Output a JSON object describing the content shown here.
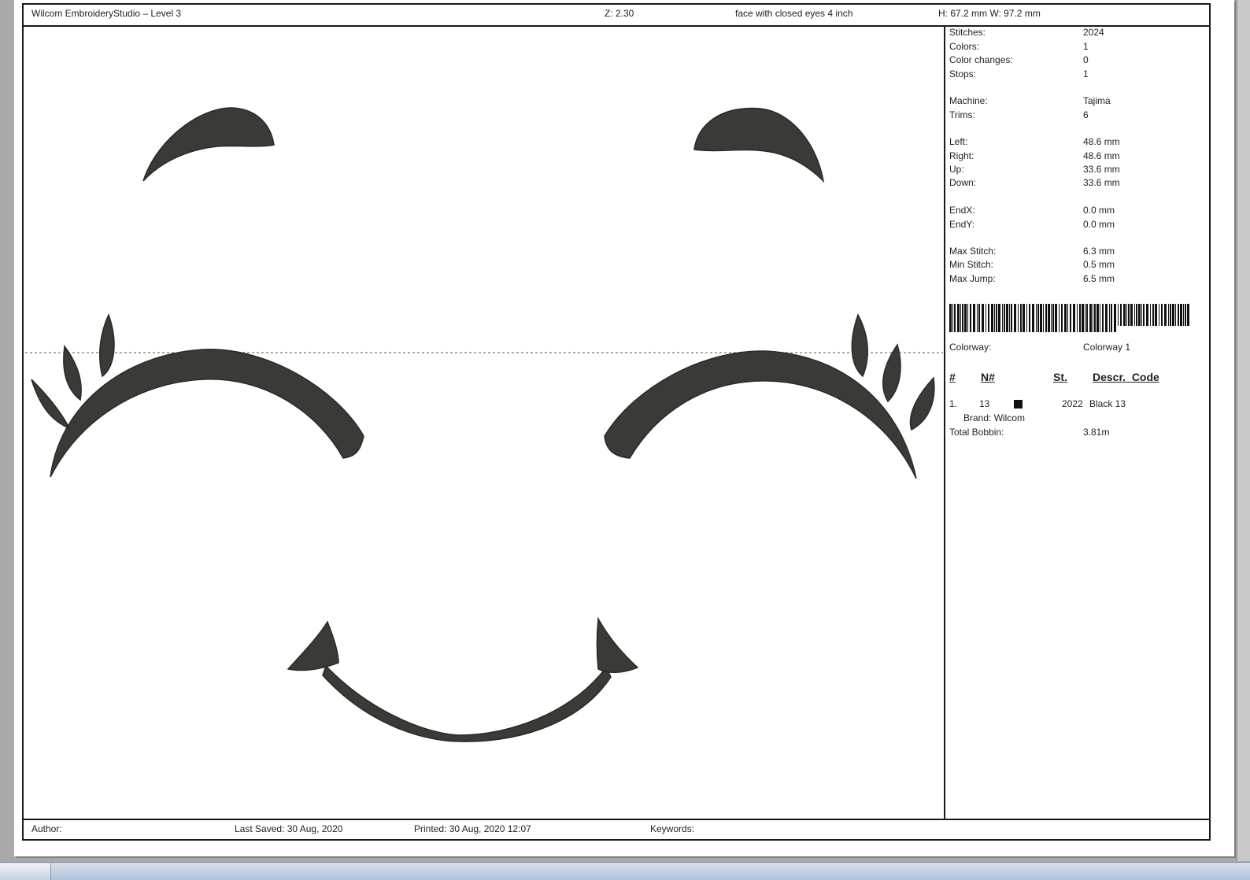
{
  "header": {
    "app_title": "Wilcom EmbroideryStudio – Level 3",
    "zoom": "Z: 2.30",
    "design_name": "face with closed eyes 4 inch",
    "dimensions": "H: 67.2 mm  W: 97.2 mm"
  },
  "stats": [
    {
      "label": "Stitches:",
      "value": "2024"
    },
    {
      "label": "Colors:",
      "value": "1"
    },
    {
      "label": "Color changes:",
      "value": "0"
    },
    {
      "label": "Stops:",
      "value": "1"
    },
    {
      "label": "Machine:",
      "value": "Tajima"
    },
    {
      "label": "Trims:",
      "value": "6"
    },
    {
      "label": "Left:",
      "value": "48.6 mm"
    },
    {
      "label": "Right:",
      "value": "48.6 mm"
    },
    {
      "label": "Up:",
      "value": "33.6 mm"
    },
    {
      "label": "Down:",
      "value": "33.6 mm"
    },
    {
      "label": "EndX:",
      "value": "0.0 mm"
    },
    {
      "label": "EndY:",
      "value": "0.0 mm"
    },
    {
      "label": "Max Stitch:",
      "value": "6.3 mm"
    },
    {
      "label": "Min Stitch:",
      "value": "0.5 mm"
    },
    {
      "label": "Max Jump:",
      "value": "6.5 mm"
    }
  ],
  "colorway": {
    "label": "Colorway:",
    "value": "Colorway 1"
  },
  "color_table": {
    "headers": [
      "#",
      "N#",
      "St.",
      "Descr._Code"
    ],
    "rows": [
      {
        "index": "1.",
        "number": "13",
        "swatch_color": "#111111",
        "stitches": "2022",
        "descr": "Black 13",
        "brand": "Brand: Wilcom"
      }
    ]
  },
  "bobbin": {
    "label": "Total Bobbin:",
    "value": "3.81m"
  },
  "footer": {
    "author": "Author:",
    "last_saved": "Last Saved: 30 Aug, 2020",
    "printed": "Printed: 30 Aug, 2020 12:07",
    "keywords": "Keywords:"
  },
  "colors": {
    "thread": "#3a3a36",
    "border": "#1a1a1a",
    "background": "#a9a9a9"
  }
}
